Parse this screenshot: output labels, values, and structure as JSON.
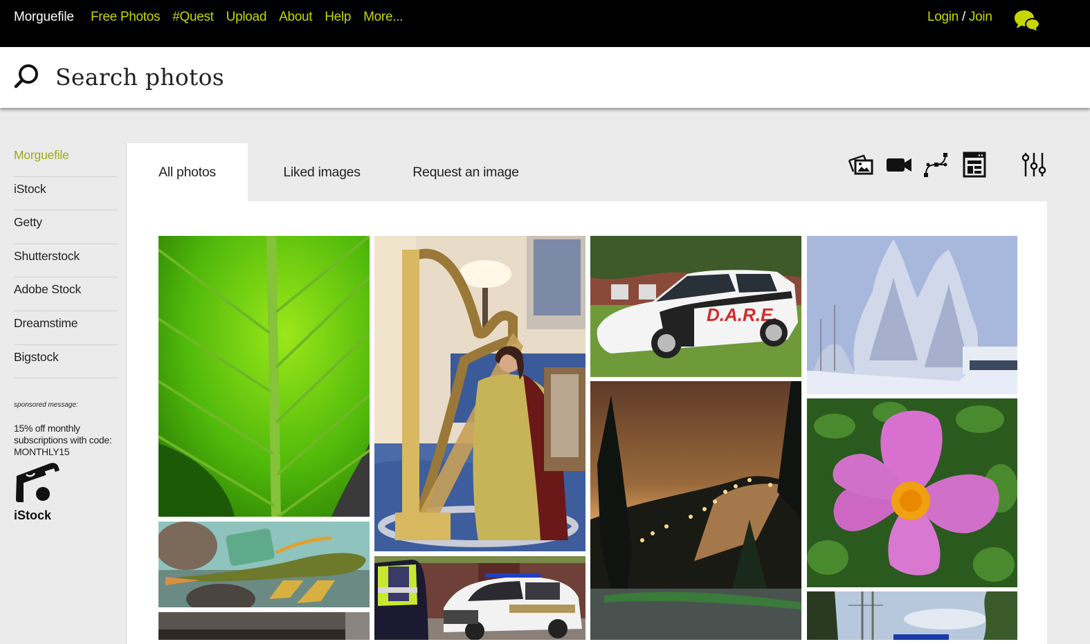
{
  "topnav": {
    "brand": "Morguefile",
    "links": [
      "Free Photos",
      "#Quest",
      "Upload",
      "About",
      "Help",
      "More..."
    ],
    "login": "Login",
    "separator": " / ",
    "join": "Join",
    "chat_icon": "chat-bubbles-icon",
    "accent_color": "#c5d600"
  },
  "search": {
    "placeholder": "Search photos",
    "value": "",
    "icon": "search-icon"
  },
  "sidebar": {
    "items": [
      {
        "label": "Morguefile",
        "active": true
      },
      {
        "label": "iStock",
        "active": false
      },
      {
        "label": "Getty",
        "active": false
      },
      {
        "label": "Shutterstock",
        "active": false
      },
      {
        "label": "Adobe Stock",
        "active": false
      },
      {
        "label": "Dreamstime",
        "active": false
      },
      {
        "label": "Bigstock",
        "active": false
      }
    ],
    "sponsored": {
      "label": "sponsored message:",
      "text": "15% off monthly subscriptions with code: MONTHLY15",
      "brand": "iStock",
      "logo_icon": "istock-camera-icon"
    }
  },
  "tabs": [
    {
      "label": "All photos",
      "active": true
    },
    {
      "label": "Liked images",
      "active": false
    },
    {
      "label": "Request an image",
      "active": false
    }
  ],
  "toolbar": {
    "icons": [
      "photos-filter-icon",
      "video-filter-icon",
      "vector-filter-icon",
      "template-filter-icon",
      "filter-settings-icon"
    ]
  },
  "gallery": {
    "photos": [
      {
        "subject": "green leaf close-up"
      },
      {
        "subject": "pleco fish in aquarium"
      },
      {
        "subject": "dark photo (partially visible)"
      },
      {
        "subject": "woman playing golden harp"
      },
      {
        "subject": "police officer and sheriff car"
      },
      {
        "subject": "D.A.R.E. police SUV",
        "text": "D.A.R.E."
      },
      {
        "subject": "ski slope at night with lights"
      },
      {
        "subject": "snow-covered trees"
      },
      {
        "subject": "pink rock rose flower"
      },
      {
        "subject": "street with utility poles and sky"
      }
    ]
  }
}
